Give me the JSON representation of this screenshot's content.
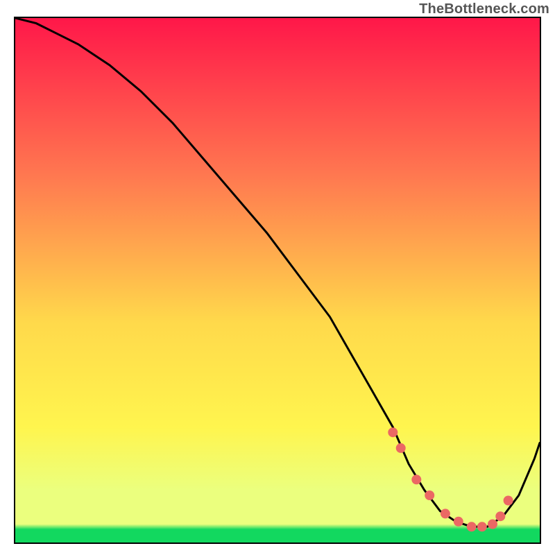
{
  "watermark": "TheBottleneck.com",
  "colors": {
    "border": "#000000",
    "curve": "#000000",
    "marker": "#eb6864",
    "grad_top": "#ff1749",
    "grad_mid_upper": "#ff7850",
    "grad_mid": "#ffd94b",
    "grad_mid_low": "#fff54e",
    "grad_pale": "#ebff7e",
    "grad_green": "#12d85f"
  },
  "chart_data": {
    "type": "line",
    "title": "",
    "xlabel": "",
    "ylabel": "",
    "xlim": [
      0,
      100
    ],
    "ylim": [
      0,
      100
    ],
    "series": [
      {
        "name": "bottleneck-curve",
        "x": [
          0,
          4,
          8,
          12,
          18,
          24,
          30,
          36,
          42,
          48,
          54,
          60,
          64,
          68,
          72,
          75,
          78,
          81,
          84,
          87,
          90,
          93,
          96,
          99,
          100
        ],
        "y": [
          100,
          99,
          97,
          95,
          91,
          86,
          80,
          73,
          66,
          59,
          51,
          43,
          36,
          29,
          22,
          15,
          10,
          6,
          4,
          3,
          3,
          5,
          9,
          16,
          19
        ]
      }
    ],
    "markers": {
      "name": "bottleneck-sweet-spot",
      "x": [
        72,
        73.5,
        76.5,
        79,
        82,
        84.5,
        87,
        89,
        91,
        92.5,
        94
      ],
      "y": [
        21,
        18,
        12,
        9,
        5.5,
        4,
        3,
        3,
        3.5,
        5,
        8
      ]
    }
  }
}
